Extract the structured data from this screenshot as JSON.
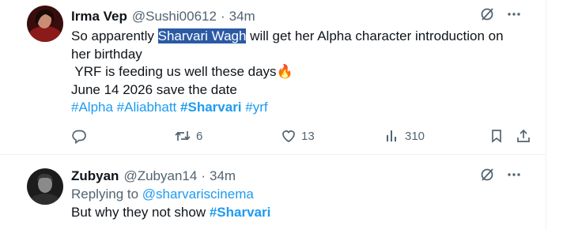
{
  "tweets": [
    {
      "author_name": "Irma Vep",
      "handle": "@Sushi00612",
      "separator": "·",
      "time": "34m",
      "line1_pre": "So apparently ",
      "line1_highlight": "Sharvari Wagh",
      "line1_post": " will get her Alpha character introduction on",
      "line2": "her birthday",
      "line3": " YRF is feeding us well these days🔥",
      "line4": "June 14 2026 save the date",
      "hashtags": [
        "#Alpha",
        "#Aliabhatt",
        "#Sharvari",
        "#yrf"
      ],
      "reply_count": "",
      "retweet_count": "6",
      "like_count": "13",
      "view_count": "310"
    },
    {
      "author_name": "Zubyan",
      "handle": "@Zubyan14",
      "separator": "·",
      "time": "34m",
      "replying_to_prefix": "Replying to ",
      "replying_to_handle": "@sharvariscinema",
      "text_pre": "But why they not show ",
      "text_tag": "#Sharvari"
    }
  ],
  "icons": {
    "grok": "grok-icon",
    "more": "more-icon",
    "reply": "reply-icon",
    "retweet": "retweet-icon",
    "like": "heart-icon",
    "views": "views-icon",
    "bookmark": "bookmark-icon",
    "share": "share-icon"
  },
  "colors": {
    "accent": "#1d9bf0",
    "secondary_text": "#536471",
    "highlight": "#2b5aa5"
  }
}
